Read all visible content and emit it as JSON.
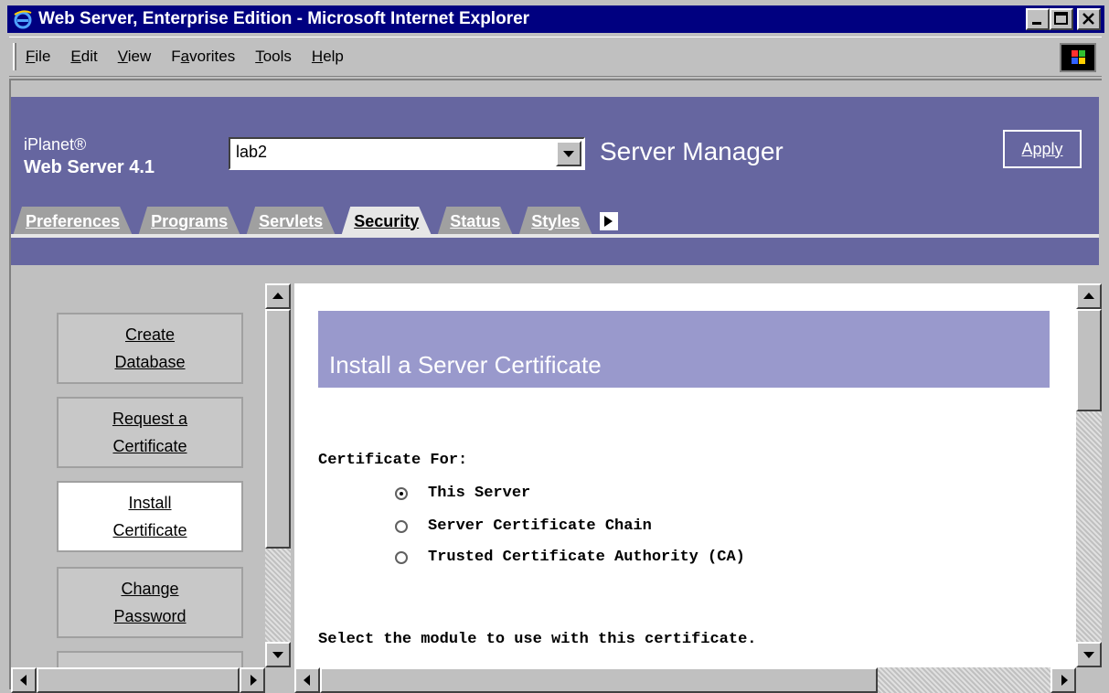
{
  "window": {
    "title": "Web Server, Enterprise Edition - Microsoft Internet Explorer"
  },
  "menubar": {
    "items": [
      {
        "label": "File",
        "accel": "F"
      },
      {
        "label": "Edit",
        "accel": "E"
      },
      {
        "label": "View",
        "accel": "V"
      },
      {
        "label": "Favorites",
        "accel": "a"
      },
      {
        "label": "Tools",
        "accel": "T"
      },
      {
        "label": "Help",
        "accel": "H"
      }
    ]
  },
  "header": {
    "brand_small": "iPlanet®",
    "brand_big": "Web Server 4.1",
    "server_value": "lab2",
    "section_title": "Server Manager",
    "apply_label": "Apply"
  },
  "tabs": [
    {
      "label": "Preferences",
      "active": false
    },
    {
      "label": "Programs",
      "active": false
    },
    {
      "label": "Servlets",
      "active": false
    },
    {
      "label": "Security",
      "active": true
    },
    {
      "label": "Status",
      "active": false
    },
    {
      "label": "Styles",
      "active": false
    }
  ],
  "sidebar": {
    "items": [
      {
        "line1": "Create",
        "line2": "Database",
        "active": false
      },
      {
        "line1": "Request a",
        "line2": "Certificate",
        "active": false
      },
      {
        "line1": "Install",
        "line2": "Certificate",
        "active": true
      },
      {
        "line1": "Change",
        "line2": "Password",
        "active": false
      }
    ]
  },
  "main": {
    "page_title": "Install a Server Certificate",
    "cert_for_label": "Certificate For:",
    "options": [
      {
        "label": "This Server",
        "checked": true
      },
      {
        "label": "Server Certificate Chain",
        "checked": false
      },
      {
        "label": "Trusted Certificate Authority (CA)",
        "checked": false
      }
    ],
    "module_prompt": "Select the module to use with this certificate."
  }
}
